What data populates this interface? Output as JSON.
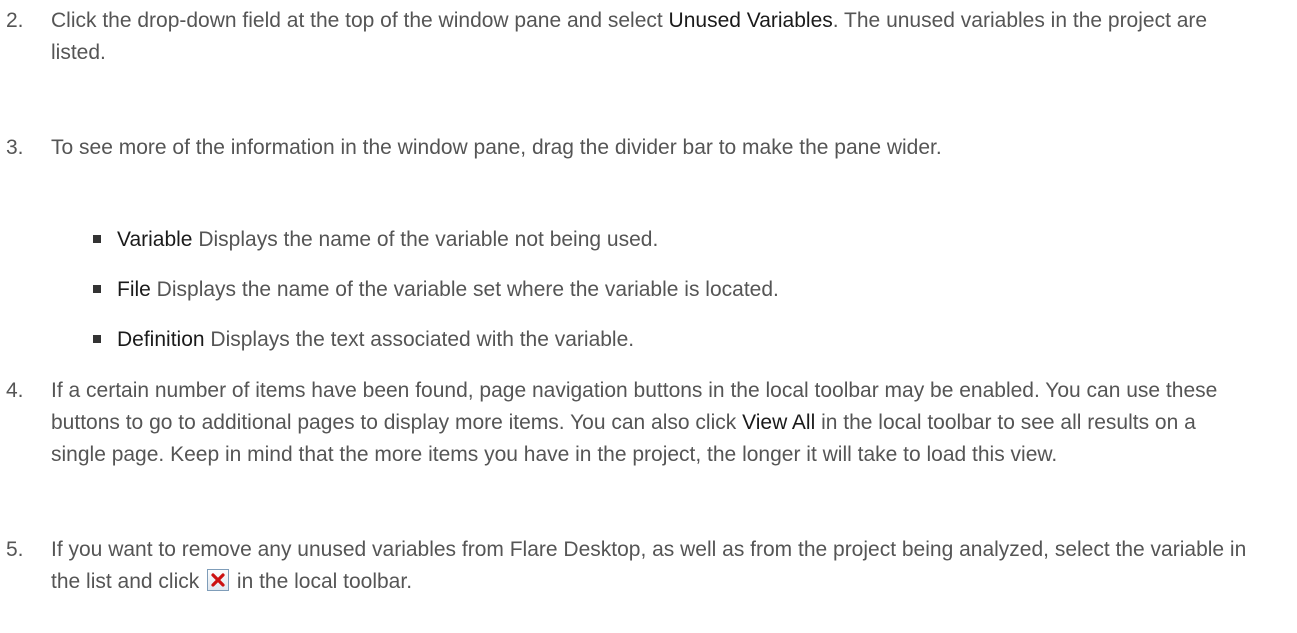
{
  "steps": [
    {
      "number": "2.",
      "text_before": "Click the drop-down field at the top of the window pane and select ",
      "emphasis": "Unused Variables",
      "text_after": ". The unused variables in the project are listed."
    },
    {
      "number": "3.",
      "text": "To see more of the information in the window pane, drag the divider bar to make the pane wider."
    },
    {
      "number": "4.",
      "text_before": "If a certain number of items have been found, page navigation buttons in the local toolbar may be enabled. You can use these buttons to go to additional pages to display more items. You can also click ",
      "emphasis": "View All",
      "text_after": " in the local toolbar to see all results on a single page. Keep in mind that the more items you have in the project, the longer it will take to load this view."
    },
    {
      "number": "5.",
      "text_before": "If you want to remove any unused variables from Flare Desktop, as well as from the project being analyzed, select the variable in the list and click ",
      "icon": "delete-x-icon",
      "text_after": " in the local toolbar."
    }
  ],
  "columns": [
    {
      "term": "Variable",
      "description": " Displays the name of the variable not being used."
    },
    {
      "term": "File",
      "description": " Displays the name of the variable set where the variable is located."
    },
    {
      "term": "Definition",
      "description": " Displays the text associated with the variable."
    }
  ],
  "colors": {
    "body_text": "#555555",
    "emphasis_text": "#1a1a1a",
    "delete_icon": "#cc1111"
  }
}
